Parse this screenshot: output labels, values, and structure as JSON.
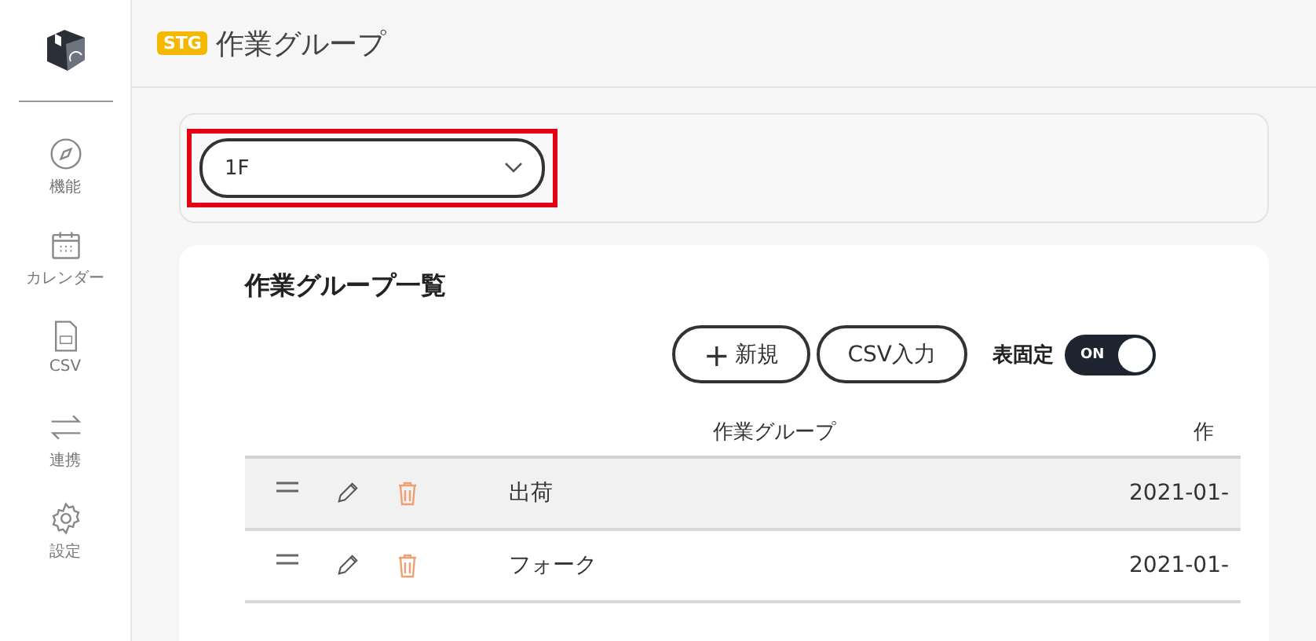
{
  "sidebar": {
    "items": [
      {
        "label": "機能",
        "kind": "compass"
      },
      {
        "label": "カレンダー",
        "kind": "calendar"
      },
      {
        "label": "CSV",
        "kind": "csv"
      },
      {
        "label": "連携",
        "kind": "sync"
      },
      {
        "label": "設定",
        "kind": "settings"
      }
    ]
  },
  "header": {
    "badge": "STG",
    "title": "作業グループ"
  },
  "filter": {
    "value": "1F",
    "highlighted": true
  },
  "card": {
    "title": "作業グループ一覧",
    "buttons": [
      {
        "icon": "+",
        "label": "新規"
      },
      {
        "label": "CSV入力"
      }
    ],
    "pin": {
      "label": "表固定",
      "on": true,
      "state_text": "ON"
    },
    "table": {
      "columns": [
        "作業グループ",
        "作"
      ],
      "rows": [
        {
          "name": "出荷",
          "date": "2021-01-",
          "selected": true
        },
        {
          "name": "フォーク",
          "date": "2021-01-",
          "selected": false
        }
      ]
    }
  }
}
